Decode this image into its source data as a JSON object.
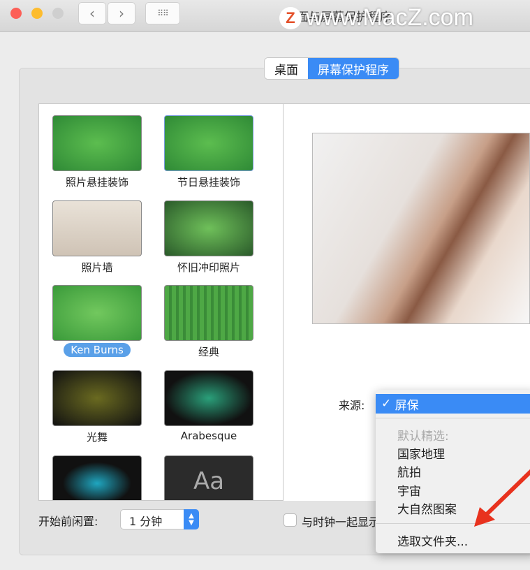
{
  "window": {
    "title": "面与屏幕保护程序",
    "watermark": "www.MacZ.com",
    "watermark_logo": "Z"
  },
  "tabs": [
    {
      "label": "桌面",
      "active": false
    },
    {
      "label": "屏幕保护程序",
      "active": true
    }
  ],
  "savers": [
    {
      "label": "照片悬挂装饰"
    },
    {
      "label": "节日悬挂装饰"
    },
    {
      "label": "照片墙"
    },
    {
      "label": "怀旧冲印照片"
    },
    {
      "label": "Ken Burns",
      "selected": true
    },
    {
      "label": "经典"
    },
    {
      "label": "光舞"
    },
    {
      "label": "Arabesque"
    },
    {
      "label": ""
    },
    {
      "label": "",
      "glyph": "Aa"
    }
  ],
  "source": {
    "label": "来源:",
    "menu": {
      "selected": "屏保",
      "section_header": "默认精选:",
      "items": [
        "国家地理",
        "航拍",
        "宇宙",
        "大自然图案"
      ],
      "choose_folder": "选取文件夹..."
    }
  },
  "idle": {
    "label": "开始前闲置:",
    "value": "1 分钟"
  },
  "clock": {
    "label": "与时钟一起显示",
    "checked": false
  },
  "colors": {
    "accent": "#3a8bf5",
    "arrow": "#e8321e"
  }
}
